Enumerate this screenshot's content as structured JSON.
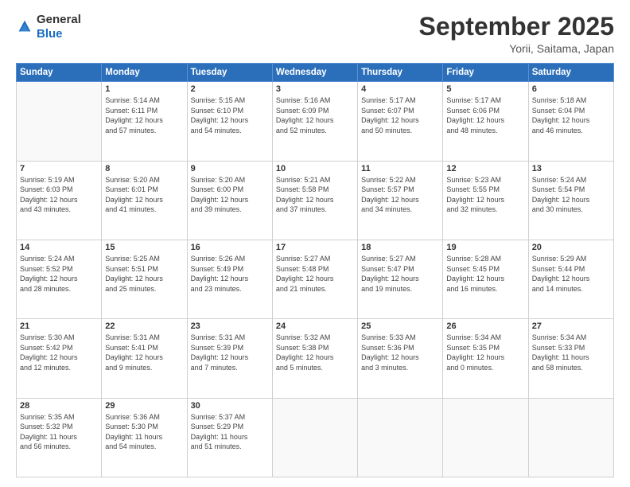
{
  "logo": {
    "general": "General",
    "blue": "Blue"
  },
  "header": {
    "month": "September 2025",
    "location": "Yorii, Saitama, Japan"
  },
  "days_of_week": [
    "Sunday",
    "Monday",
    "Tuesday",
    "Wednesday",
    "Thursday",
    "Friday",
    "Saturday"
  ],
  "weeks": [
    [
      {
        "day": "",
        "info": ""
      },
      {
        "day": "1",
        "info": "Sunrise: 5:14 AM\nSunset: 6:11 PM\nDaylight: 12 hours\nand 57 minutes."
      },
      {
        "day": "2",
        "info": "Sunrise: 5:15 AM\nSunset: 6:10 PM\nDaylight: 12 hours\nand 54 minutes."
      },
      {
        "day": "3",
        "info": "Sunrise: 5:16 AM\nSunset: 6:09 PM\nDaylight: 12 hours\nand 52 minutes."
      },
      {
        "day": "4",
        "info": "Sunrise: 5:17 AM\nSunset: 6:07 PM\nDaylight: 12 hours\nand 50 minutes."
      },
      {
        "day": "5",
        "info": "Sunrise: 5:17 AM\nSunset: 6:06 PM\nDaylight: 12 hours\nand 48 minutes."
      },
      {
        "day": "6",
        "info": "Sunrise: 5:18 AM\nSunset: 6:04 PM\nDaylight: 12 hours\nand 46 minutes."
      }
    ],
    [
      {
        "day": "7",
        "info": "Sunrise: 5:19 AM\nSunset: 6:03 PM\nDaylight: 12 hours\nand 43 minutes."
      },
      {
        "day": "8",
        "info": "Sunrise: 5:20 AM\nSunset: 6:01 PM\nDaylight: 12 hours\nand 41 minutes."
      },
      {
        "day": "9",
        "info": "Sunrise: 5:20 AM\nSunset: 6:00 PM\nDaylight: 12 hours\nand 39 minutes."
      },
      {
        "day": "10",
        "info": "Sunrise: 5:21 AM\nSunset: 5:58 PM\nDaylight: 12 hours\nand 37 minutes."
      },
      {
        "day": "11",
        "info": "Sunrise: 5:22 AM\nSunset: 5:57 PM\nDaylight: 12 hours\nand 34 minutes."
      },
      {
        "day": "12",
        "info": "Sunrise: 5:23 AM\nSunset: 5:55 PM\nDaylight: 12 hours\nand 32 minutes."
      },
      {
        "day": "13",
        "info": "Sunrise: 5:24 AM\nSunset: 5:54 PM\nDaylight: 12 hours\nand 30 minutes."
      }
    ],
    [
      {
        "day": "14",
        "info": "Sunrise: 5:24 AM\nSunset: 5:52 PM\nDaylight: 12 hours\nand 28 minutes."
      },
      {
        "day": "15",
        "info": "Sunrise: 5:25 AM\nSunset: 5:51 PM\nDaylight: 12 hours\nand 25 minutes."
      },
      {
        "day": "16",
        "info": "Sunrise: 5:26 AM\nSunset: 5:49 PM\nDaylight: 12 hours\nand 23 minutes."
      },
      {
        "day": "17",
        "info": "Sunrise: 5:27 AM\nSunset: 5:48 PM\nDaylight: 12 hours\nand 21 minutes."
      },
      {
        "day": "18",
        "info": "Sunrise: 5:27 AM\nSunset: 5:47 PM\nDaylight: 12 hours\nand 19 minutes."
      },
      {
        "day": "19",
        "info": "Sunrise: 5:28 AM\nSunset: 5:45 PM\nDaylight: 12 hours\nand 16 minutes."
      },
      {
        "day": "20",
        "info": "Sunrise: 5:29 AM\nSunset: 5:44 PM\nDaylight: 12 hours\nand 14 minutes."
      }
    ],
    [
      {
        "day": "21",
        "info": "Sunrise: 5:30 AM\nSunset: 5:42 PM\nDaylight: 12 hours\nand 12 minutes."
      },
      {
        "day": "22",
        "info": "Sunrise: 5:31 AM\nSunset: 5:41 PM\nDaylight: 12 hours\nand 9 minutes."
      },
      {
        "day": "23",
        "info": "Sunrise: 5:31 AM\nSunset: 5:39 PM\nDaylight: 12 hours\nand 7 minutes."
      },
      {
        "day": "24",
        "info": "Sunrise: 5:32 AM\nSunset: 5:38 PM\nDaylight: 12 hours\nand 5 minutes."
      },
      {
        "day": "25",
        "info": "Sunrise: 5:33 AM\nSunset: 5:36 PM\nDaylight: 12 hours\nand 3 minutes."
      },
      {
        "day": "26",
        "info": "Sunrise: 5:34 AM\nSunset: 5:35 PM\nDaylight: 12 hours\nand 0 minutes."
      },
      {
        "day": "27",
        "info": "Sunrise: 5:34 AM\nSunset: 5:33 PM\nDaylight: 11 hours\nand 58 minutes."
      }
    ],
    [
      {
        "day": "28",
        "info": "Sunrise: 5:35 AM\nSunset: 5:32 PM\nDaylight: 11 hours\nand 56 minutes."
      },
      {
        "day": "29",
        "info": "Sunrise: 5:36 AM\nSunset: 5:30 PM\nDaylight: 11 hours\nand 54 minutes."
      },
      {
        "day": "30",
        "info": "Sunrise: 5:37 AM\nSunset: 5:29 PM\nDaylight: 11 hours\nand 51 minutes."
      },
      {
        "day": "",
        "info": ""
      },
      {
        "day": "",
        "info": ""
      },
      {
        "day": "",
        "info": ""
      },
      {
        "day": "",
        "info": ""
      }
    ]
  ]
}
